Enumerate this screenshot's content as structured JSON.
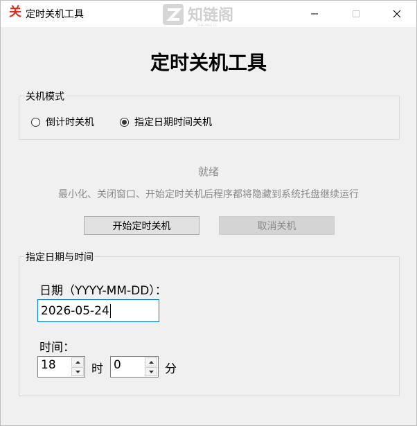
{
  "titlebar": {
    "icon_glyph": "关",
    "title": "定时关机工具",
    "watermark_text": "知链阁",
    "watermark_small": "ZHILIANGE.CC",
    "minimize_icon": "minimize-icon",
    "maximize_icon": "maximize-icon",
    "close_icon": "close-icon"
  },
  "main": {
    "heading": "定时关机工具"
  },
  "mode_group": {
    "label": "关机模式",
    "options": [
      {
        "label": "倒计时关机",
        "selected": false
      },
      {
        "label": "指定日期时间关机",
        "selected": true
      }
    ]
  },
  "status": {
    "text": "就绪",
    "hint": "最小化、关闭窗口、开始定时关机后程序都将隐藏到系统托盘继续运行"
  },
  "buttons": {
    "start": "开始定时关机",
    "cancel": "取消关机"
  },
  "datetime_group": {
    "label": "指定日期与时间",
    "date_label": "日期（YYYY-MM-DD）：",
    "date_value": "2026-05-24",
    "time_label": "时间：",
    "hour_value": "18",
    "hour_unit": "时",
    "minute_value": "0",
    "minute_unit": "分"
  },
  "colors": {
    "accent": "#e0281c",
    "focus_border": "#0078d7",
    "disabled_text": "#8a8a8a"
  }
}
